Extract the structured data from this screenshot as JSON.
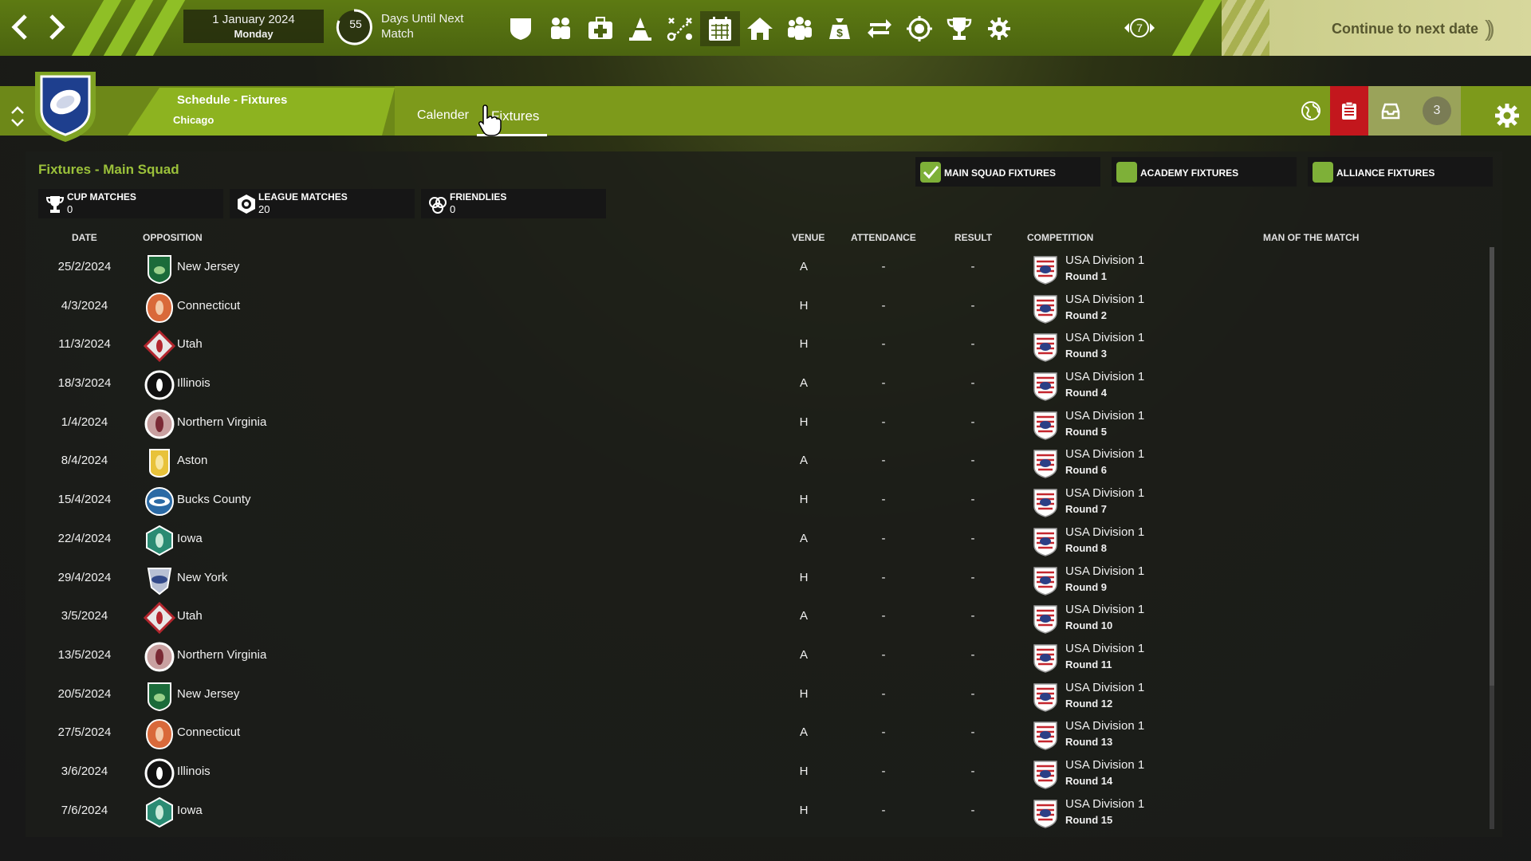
{
  "topbar": {
    "date": "1 January 2024",
    "weekday": "Monday",
    "days_until_match": "55",
    "days_until_label": "Days Until Next Match",
    "counter_badge": "7",
    "continue_label": "Continue to next date",
    "icons": [
      "shield-icon",
      "squad-icon",
      "medical-icon",
      "training-cone-icon",
      "tactics-icon",
      "calendar-icon",
      "home-icon",
      "staff-icon",
      "finance-icon",
      "transfers-icon",
      "scouting-icon",
      "trophy-icon",
      "settings-cogs-icon"
    ]
  },
  "header": {
    "breadcrumb_title": "Schedule - Fixtures",
    "breadcrumb_sub": "Chicago",
    "tabs": [
      {
        "label": "Calender"
      },
      {
        "label": "Fixtures"
      }
    ],
    "inbox_count": "3"
  },
  "panel": {
    "title": "Fixtures - Main Squad",
    "stats": [
      {
        "label": "CUP MATCHES",
        "value": "0"
      },
      {
        "label": "LEAGUE MATCHES",
        "value": "20"
      },
      {
        "label": "FRIENDLIES",
        "value": "0"
      }
    ],
    "filters": [
      {
        "label": "MAIN SQUAD FIXTURES",
        "checked": true
      },
      {
        "label": "ACADEMY FIXTURES",
        "checked": false
      },
      {
        "label": "ALLIANCE FIXTURES",
        "checked": false
      }
    ],
    "columns": {
      "date": "DATE",
      "opposition": "OPPOSITION",
      "venue": "VENUE",
      "attendance": "ATTENDANCE",
      "result": "RESULT",
      "competition": "COMPETITION",
      "motm": "MAN OF THE MATCH"
    }
  },
  "fixtures": [
    {
      "date": "25/2/2024",
      "opp": "New Jersey",
      "crest": "new-jersey",
      "venue": "A",
      "att": "-",
      "res": "-",
      "comp": "USA Division 1",
      "round": "Round 1"
    },
    {
      "date": "4/3/2024",
      "opp": "Connecticut",
      "crest": "connecticut",
      "venue": "H",
      "att": "-",
      "res": "-",
      "comp": "USA Division 1",
      "round": "Round 2"
    },
    {
      "date": "11/3/2024",
      "opp": "Utah",
      "crest": "utah",
      "venue": "H",
      "att": "-",
      "res": "-",
      "comp": "USA Division 1",
      "round": "Round 3"
    },
    {
      "date": "18/3/2024",
      "opp": "Illinois",
      "crest": "illinois",
      "venue": "A",
      "att": "-",
      "res": "-",
      "comp": "USA Division 1",
      "round": "Round 4"
    },
    {
      "date": "1/4/2024",
      "opp": "Northern Virginia",
      "crest": "northern-virginia",
      "venue": "H",
      "att": "-",
      "res": "-",
      "comp": "USA Division 1",
      "round": "Round 5"
    },
    {
      "date": "8/4/2024",
      "opp": "Aston",
      "crest": "aston",
      "venue": "A",
      "att": "-",
      "res": "-",
      "comp": "USA Division 1",
      "round": "Round 6"
    },
    {
      "date": "15/4/2024",
      "opp": "Bucks County",
      "crest": "bucks-county",
      "venue": "H",
      "att": "-",
      "res": "-",
      "comp": "USA Division 1",
      "round": "Round 7"
    },
    {
      "date": "22/4/2024",
      "opp": "Iowa",
      "crest": "iowa",
      "venue": "A",
      "att": "-",
      "res": "-",
      "comp": "USA Division 1",
      "round": "Round 8"
    },
    {
      "date": "29/4/2024",
      "opp": "New York",
      "crest": "new-york",
      "venue": "H",
      "att": "-",
      "res": "-",
      "comp": "USA Division 1",
      "round": "Round 9"
    },
    {
      "date": "3/5/2024",
      "opp": "Utah",
      "crest": "utah",
      "venue": "A",
      "att": "-",
      "res": "-",
      "comp": "USA Division 1",
      "round": "Round 10"
    },
    {
      "date": "13/5/2024",
      "opp": "Northern Virginia",
      "crest": "northern-virginia",
      "venue": "A",
      "att": "-",
      "res": "-",
      "comp": "USA Division 1",
      "round": "Round 11"
    },
    {
      "date": "20/5/2024",
      "opp": "New Jersey",
      "crest": "new-jersey",
      "venue": "H",
      "att": "-",
      "res": "-",
      "comp": "USA Division 1",
      "round": "Round 12"
    },
    {
      "date": "27/5/2024",
      "opp": "Connecticut",
      "crest": "connecticut",
      "venue": "A",
      "att": "-",
      "res": "-",
      "comp": "USA Division 1",
      "round": "Round 13"
    },
    {
      "date": "3/6/2024",
      "opp": "Illinois",
      "crest": "illinois",
      "venue": "H",
      "att": "-",
      "res": "-",
      "comp": "USA Division 1",
      "round": "Round 14"
    },
    {
      "date": "7/6/2024",
      "opp": "Iowa",
      "crest": "iowa",
      "venue": "H",
      "att": "-",
      "res": "-",
      "comp": "USA Division 1",
      "round": "Round 15"
    }
  ],
  "colors": {
    "accent": "#8db320",
    "title_green": "#9bc13a",
    "alert_red": "#c3171d",
    "checkbox_green": "#7eb038"
  }
}
